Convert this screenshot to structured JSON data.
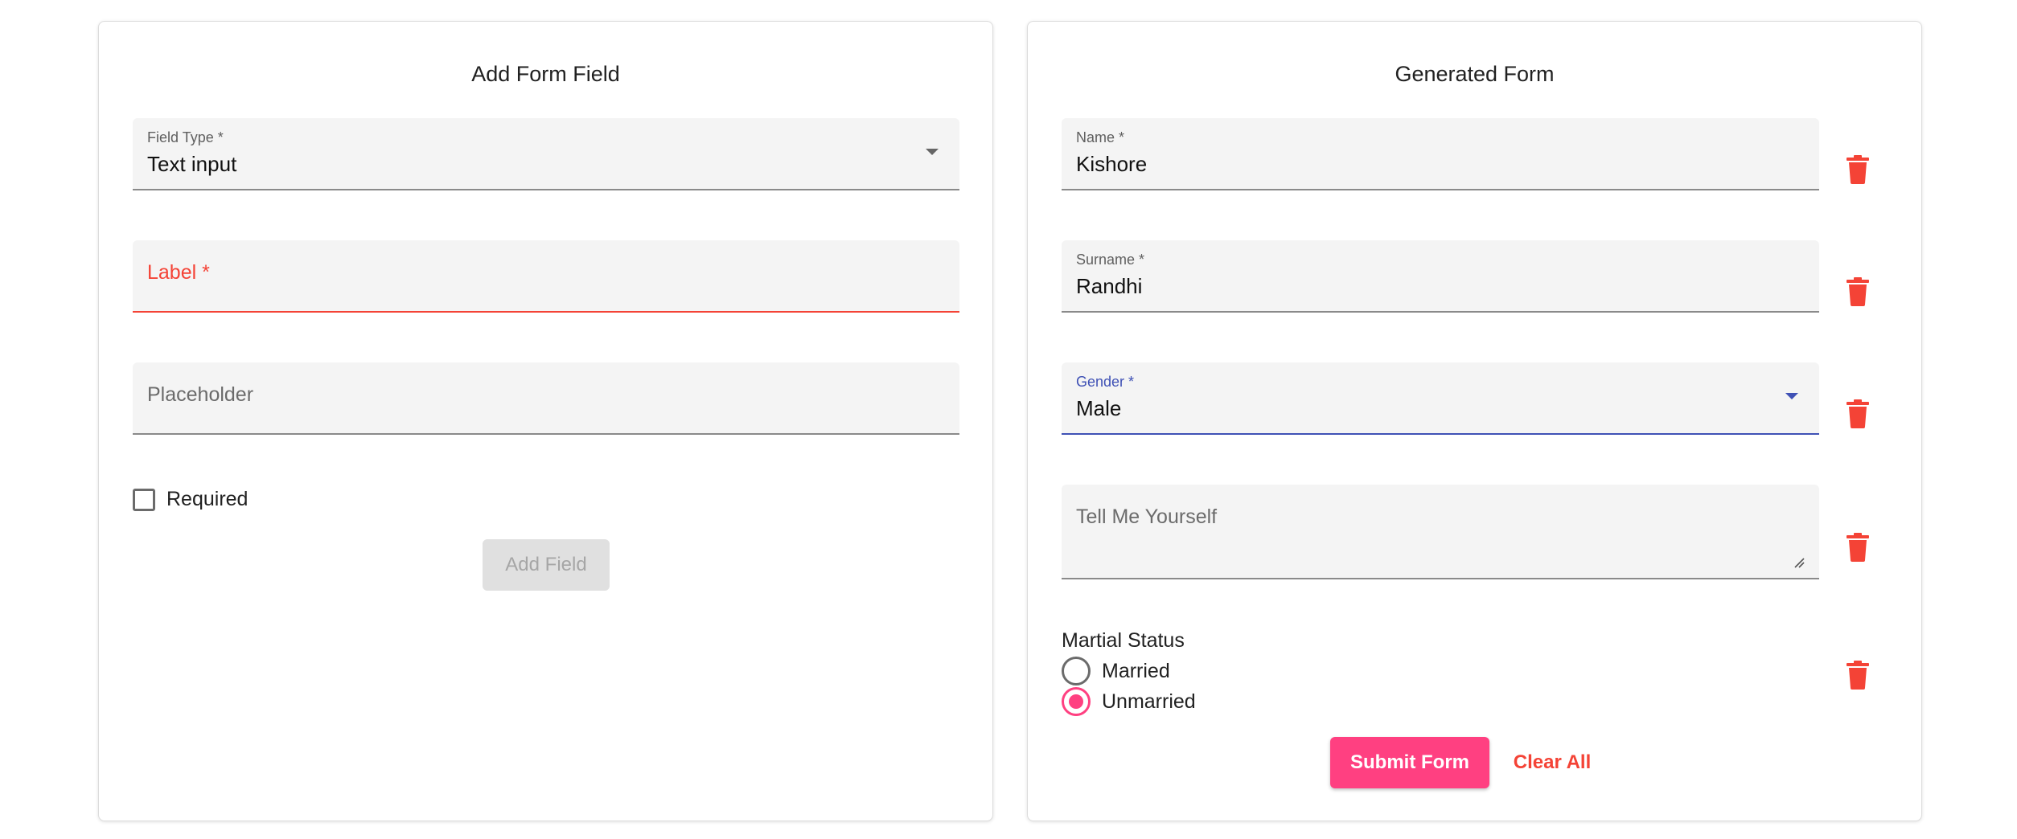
{
  "add_form": {
    "title": "Add Form Field",
    "field_type": {
      "label": "Field Type *",
      "value": "Text input"
    },
    "label_field": {
      "placeholder": "Label *"
    },
    "placeholder_field": {
      "placeholder": "Placeholder"
    },
    "required_label": "Required",
    "required_checked": false,
    "add_button": "Add Field"
  },
  "generated_form": {
    "title": "Generated Form",
    "name": {
      "label": "Name *",
      "value": "Kishore"
    },
    "surname": {
      "label": "Surname *",
      "value": "Randhi"
    },
    "gender": {
      "label": "Gender *",
      "value": "Male"
    },
    "about": {
      "placeholder": "Tell Me Yourself"
    },
    "marital": {
      "title": "Martial Status",
      "options": [
        "Married",
        "Unmarried"
      ],
      "selected": "Unmarried"
    },
    "submit_button": "Submit Form",
    "clear_button": "Clear All"
  },
  "colors": {
    "accent": "#ff4081",
    "error": "#f44336",
    "focus": "#3f51b5",
    "trash": "#f44336"
  },
  "icons": {
    "delete": "trash-icon",
    "dropdown": "caret-down-icon"
  }
}
